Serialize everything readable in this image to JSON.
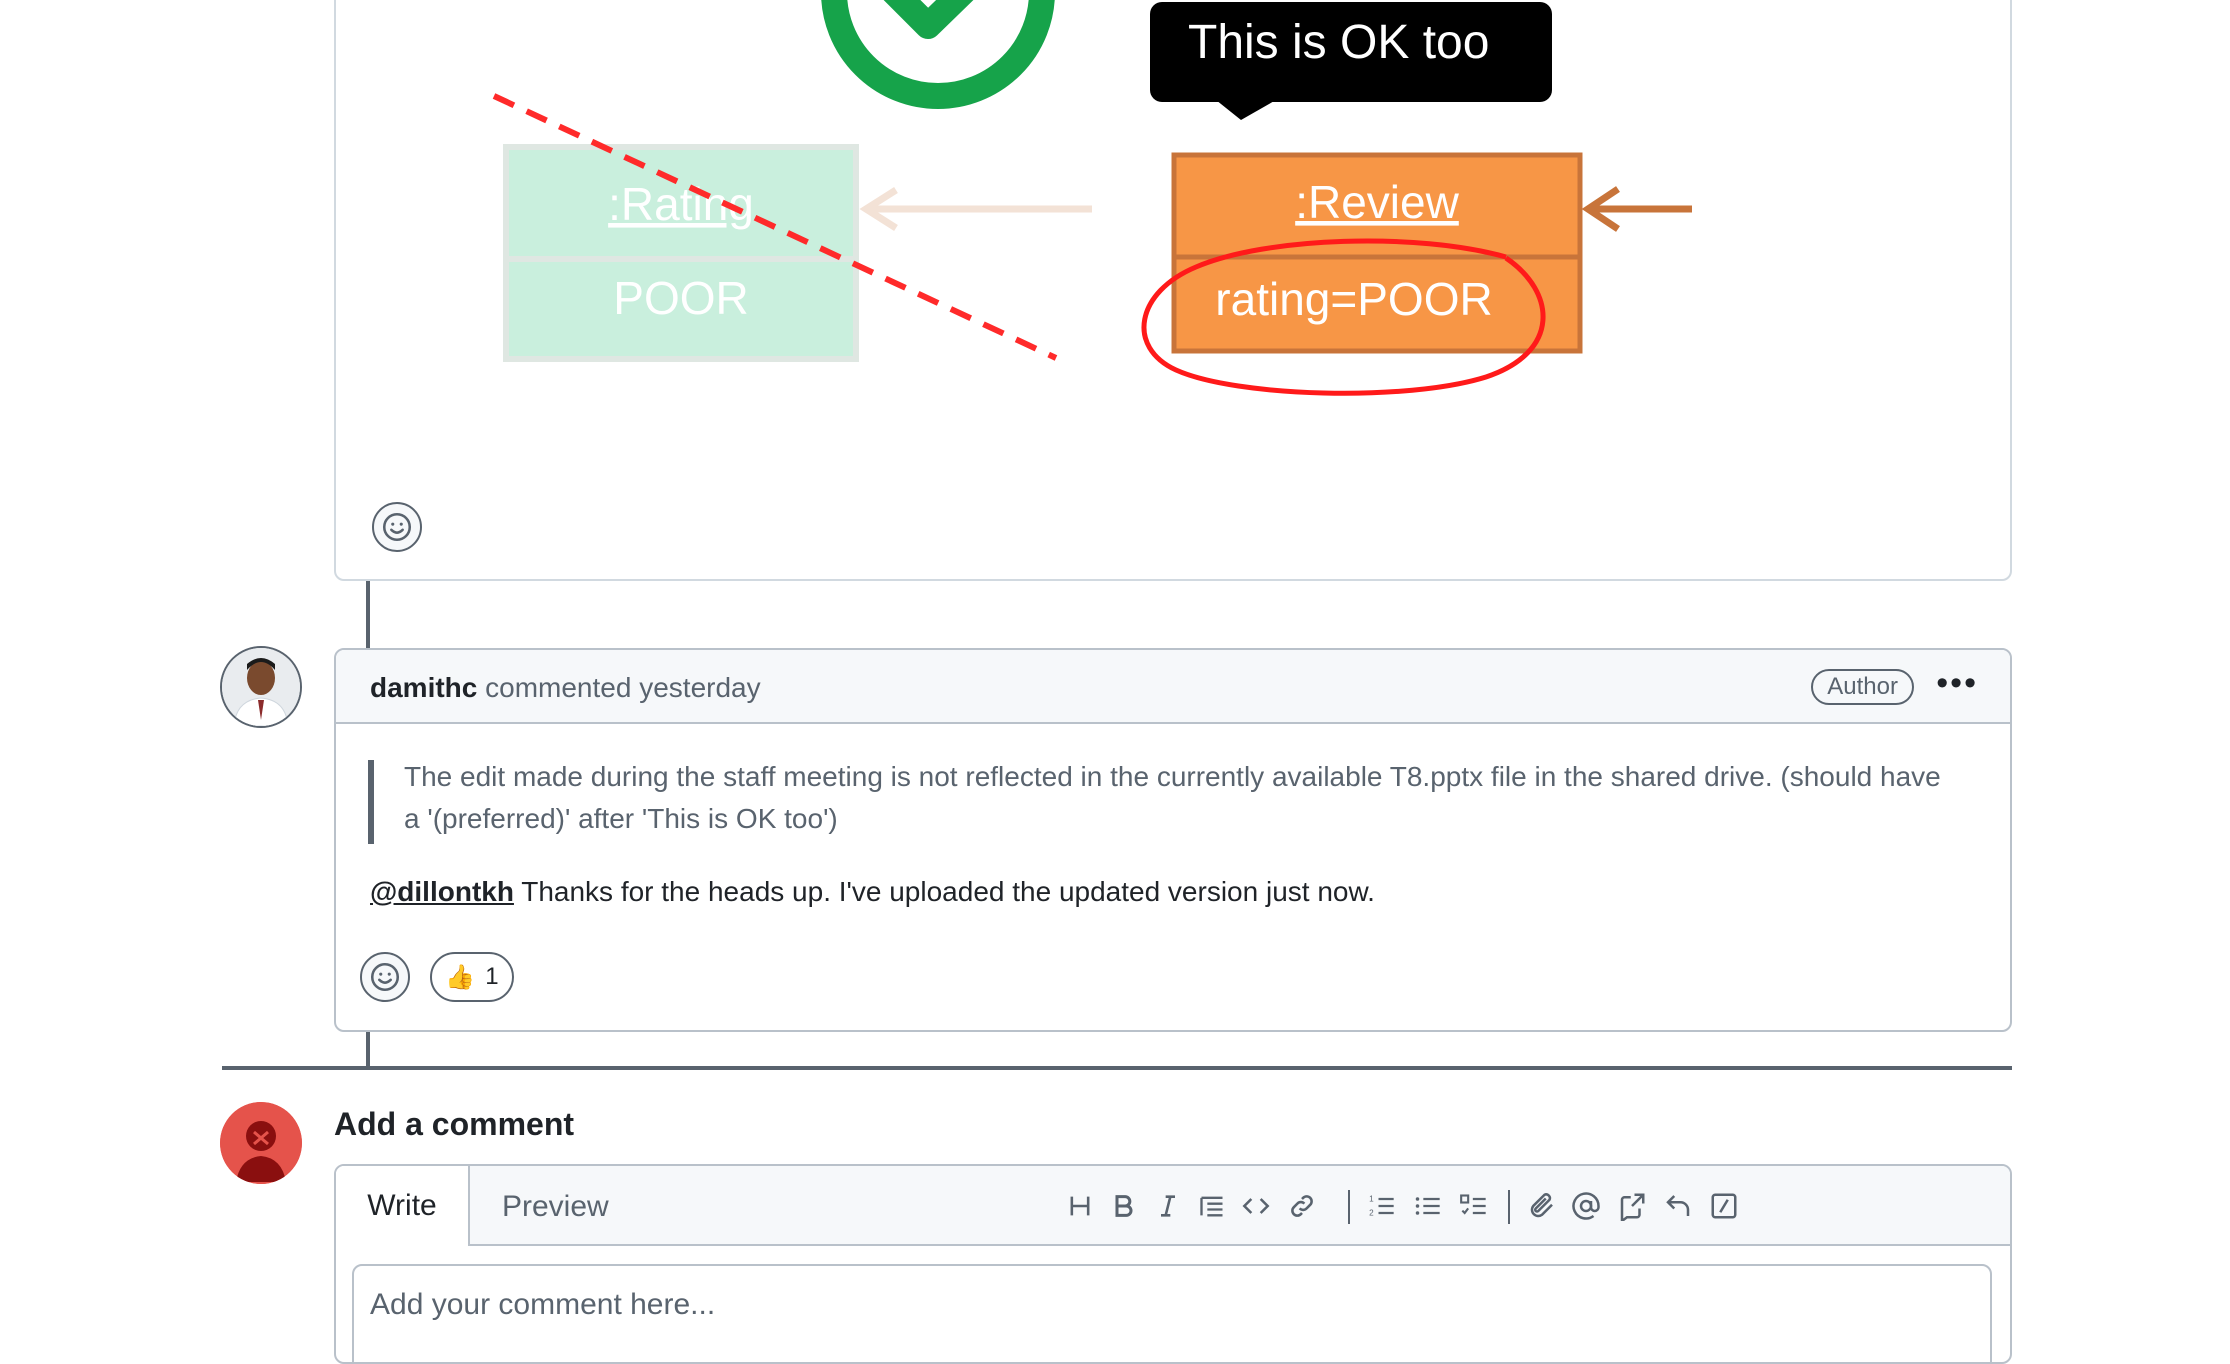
{
  "diagram": {
    "callout": "This is OK too",
    "left_box": {
      "title": ":Rating",
      "value": "POOR"
    },
    "right_box": {
      "title": ":Review",
      "value": "rating=POOR"
    },
    "colors": {
      "green_check": "#16a34a",
      "faded_green": "#c9efdd",
      "orange": "#f79646",
      "orange_border": "#c8743a",
      "strike_red": "#ff2a2a"
    }
  },
  "comment": {
    "author": "damithc",
    "action": "commented",
    "time": "yesterday",
    "badge": "Author",
    "more_icon": "kebab-horizontal-icon",
    "quote": "The edit made during the staff meeting is not reflected in the currently available T8.pptx file in the shared drive. (should have a '(preferred)' after 'This is OK too')",
    "mention": "@dillontkh",
    "reply": " Thanks for the heads up. I've uploaded the updated version just now.",
    "reactions": [
      {
        "emoji": "👍",
        "count": "1"
      }
    ]
  },
  "composer": {
    "title": "Add a comment",
    "tabs": {
      "write": "Write",
      "preview": "Preview"
    },
    "placeholder": "Add your comment here...",
    "toolbar": [
      "heading-icon",
      "bold-icon",
      "italic-icon",
      "quote-icon",
      "code-icon",
      "link-icon",
      "ordered-list-icon",
      "unordered-list-icon",
      "task-list-icon",
      "attach-icon",
      "mention-icon",
      "cross-reference-icon",
      "reply-icon",
      "slash-command-icon"
    ]
  },
  "colors": {
    "border": "#d1d9e0",
    "header_bg": "#f6f8fa",
    "muted": "#59636e",
    "avatar_red": "#e5534b"
  }
}
